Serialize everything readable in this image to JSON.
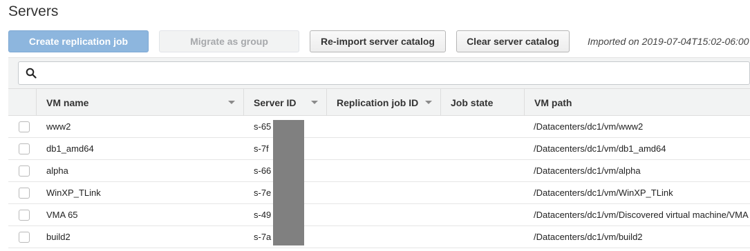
{
  "page": {
    "title": "Servers"
  },
  "toolbar": {
    "create_label": "Create replication job",
    "migrate_label": "Migrate as group",
    "reimport_label": "Re-import server catalog",
    "clear_label": "Clear server catalog",
    "imported_text": "Imported on 2019-07-04T15:02-06:00"
  },
  "search": {
    "placeholder": ""
  },
  "table": {
    "columns": [
      "VM name",
      "Server ID",
      "Replication job ID",
      "Job state",
      "VM path"
    ],
    "rows": [
      {
        "vm_name": "www2",
        "server_id": "s-65",
        "replication_job_id": "",
        "job_state": "",
        "vm_path": "/Datacenters/dc1/vm/www2"
      },
      {
        "vm_name": "db1_amd64",
        "server_id": "s-7f",
        "replication_job_id": "",
        "job_state": "",
        "vm_path": "/Datacenters/dc1/vm/db1_amd64"
      },
      {
        "vm_name": "alpha",
        "server_id": "s-66",
        "replication_job_id": "",
        "job_state": "",
        "vm_path": "/Datacenters/dc1/vm/alpha"
      },
      {
        "vm_name": "WinXP_TLink",
        "server_id": "s-7e",
        "replication_job_id": "",
        "job_state": "",
        "vm_path": "/Datacenters/dc1/vm/WinXP_TLink"
      },
      {
        "vm_name": "VMA 65",
        "server_id": "s-49",
        "replication_job_id": "",
        "job_state": "",
        "vm_path": "/Datacenters/dc1/vm/Discovered virtual machine/VMA"
      },
      {
        "vm_name": "build2",
        "server_id": "s-7a",
        "replication_job_id": "",
        "job_state": "",
        "vm_path": "/Datacenters/dc1/vm/build2"
      }
    ]
  },
  "colors": {
    "primary": "#8db6de",
    "header_bg": "#f2f3f3",
    "redaction": "#808080"
  }
}
